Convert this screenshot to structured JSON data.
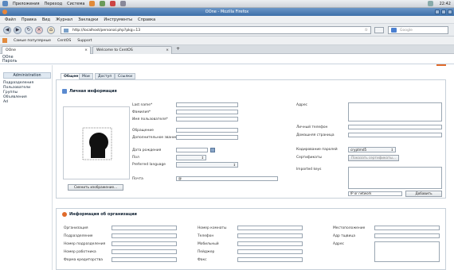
{
  "gnome_panel": {
    "items": [
      "Приложения",
      "Переход",
      "Система"
    ],
    "clock": "22:42"
  },
  "window": {
    "title": "OOne - Mozilla Firefox"
  },
  "menubar": {
    "items": [
      "Файл",
      "Правка",
      "Вид",
      "Журнал",
      "Закладки",
      "Инструменты",
      "Справка"
    ]
  },
  "navbar": {
    "url": "http://localhost/personal.php?pkg=13",
    "search_placeholder": "Google"
  },
  "bookmarks": {
    "items": [
      "Самые популярные",
      "CentOS",
      "Support"
    ]
  },
  "browser_tabs": [
    {
      "label": "OOne"
    },
    {
      "label": "Welcome to CentOS"
    }
  ],
  "app": {
    "name": "OOne",
    "sub": "Пароль"
  },
  "sidebar": {
    "header": "Administration",
    "links": [
      "Подразделения",
      "Пользователи",
      "Группы",
      "Объявления",
      "Ad"
    ]
  },
  "page_tabs": [
    "Общее",
    "Мои",
    "Доступ",
    "Ссылки"
  ],
  "personal": {
    "title": "Личная информация",
    "photo_button": "Сменить изображение...",
    "labels": {
      "last_name": "Last name*",
      "first_name": "Фамилия*",
      "middle_name": "Имя пользователя*",
      "salutation": "Обращение",
      "suffix": "Дополнительное звание",
      "birthday": "Дата рождения",
      "gender": "Пол",
      "lang": "Preferred language",
      "email": "Почта",
      "address": "Адрес",
      "mobile": "Личный телефон",
      "homepage": "Домашняя страница",
      "encryption": "Кодирование паролей",
      "certs": "Сертификаты",
      "imported": "Imported keys"
    },
    "email_value": "@",
    "encryption_value": "cryptmd5",
    "certs_button": "Показать сертификаты...",
    "network_value": "IP or network",
    "add_button": "Добавить"
  },
  "org": {
    "title": "Информация об организации",
    "col1": [
      "Организация",
      "Подразделение",
      "Номер подразделения",
      "Номер работника",
      "Форма кредиторства"
    ],
    "col2": [
      "Номер комнаты",
      "Телефон",
      "Мобильный",
      "Пейджер",
      "Факс"
    ],
    "col3": [
      "Местоположение",
      "Адр тщвица",
      "Адрес"
    ]
  },
  "colors": {
    "accent": "#3d6fa8",
    "header_bg": "#dfe8f1"
  }
}
